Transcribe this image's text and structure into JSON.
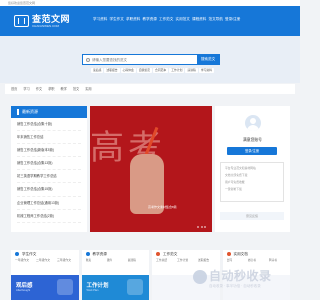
{
  "topbar": {
    "welcome": "您好欢迎您查范文网"
  },
  "header": {
    "logo_main": "查范文网",
    "logo_sub": "CHAFANWEN.COM",
    "nav": [
      "学习资料",
      "学生作文",
      "求职资料",
      "教学资源",
      "工作范文",
      "实用范文",
      "课程资料",
      "范文导航",
      "登录/注册"
    ]
  },
  "search": {
    "placeholder": "请输入您要查找的范文",
    "button": "搜索范文",
    "tags": [
      "读后感",
      "述职报告",
      "心得体会",
      "自我鉴定",
      "合同范本",
      "工作计划",
      "演讲稿",
      "学习资料"
    ]
  },
  "catbar": {
    "items": [
      "首页",
      "学习",
      "作文",
      "求职",
      "教学",
      "范文",
      "实用"
    ]
  },
  "sidebar": {
    "title": "最新资源",
    "items": [
      "销售工作总结(合集十篇)",
      "年末销售工作总结",
      "销售工作总结(新版本5篇)",
      "销售工作总结(合集13篇)",
      "初三英语学期教学工作总结",
      "销售工作总结(合集15篇)",
      "企业管理工作总结(通用13篇)",
      "机械工程师工作总结(2篇)"
    ]
  },
  "banner": {
    "glyphs": "高考",
    "caption": "高考作文素材集合8篇"
  },
  "panel": {
    "greeting": "满意您账号",
    "login_button": "登录/注册",
    "lines": [
      "平台专业范文和素材网站",
      "文档全部免费下载",
      "用户可免费收藏",
      "一键复制下载"
    ],
    "feedback": "意见反馈"
  },
  "sections": [
    {
      "title": "学生作文",
      "color": "#1677d8",
      "links": [
        "一年级作文",
        "二年级作文",
        "三年级作文",
        "四年级作文",
        "五年级作文",
        "六年级作文"
      ]
    },
    {
      "title": "教学资源",
      "color": "#1677d8",
      "links": [
        "教案",
        "课件",
        "说课稿",
        "试题",
        "评课稿",
        "学案"
      ]
    },
    {
      "title": "工作范文",
      "color": "#e0542e",
      "links": [
        "工作总结",
        "工作计划",
        "述职报告",
        "心得体会",
        "演讲稿",
        "工作报告"
      ]
    },
    {
      "title": "实用文档",
      "color": "#e0542e",
      "links": [
        "合同",
        "协议书",
        "申请书",
        "证明",
        "保证书",
        "承诺书"
      ]
    }
  ],
  "promo": [
    {
      "title": "观后感",
      "sub": "Afterthought"
    },
    {
      "title": "工作计划",
      "sub": "Work Plan"
    }
  ],
  "watermark": {
    "big": "自动秒收录",
    "small": "自动收录 · 事半功倍 · 自动秒收录"
  }
}
